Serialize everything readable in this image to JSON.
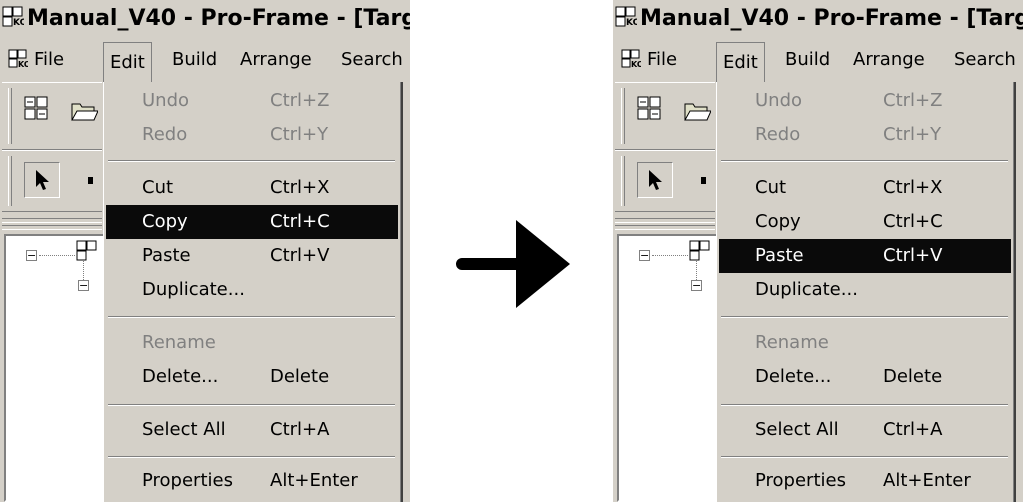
{
  "window": {
    "title": "Manual_V40 - Pro-Frame - [Targ",
    "menubar": [
      "File",
      "Edit",
      "Build",
      "Arrange",
      "Search"
    ]
  },
  "menu": {
    "items": [
      {
        "label": "Undo",
        "shortcut": "Ctrl+Z",
        "disabled": true
      },
      {
        "label": "Redo",
        "shortcut": "Ctrl+Y",
        "disabled": true
      },
      {
        "label": "Cut",
        "shortcut": "Ctrl+X",
        "disabled": false
      },
      {
        "label": "Copy",
        "shortcut": "Ctrl+C",
        "disabled": false
      },
      {
        "label": "Paste",
        "shortcut": "Ctrl+V",
        "disabled": false
      },
      {
        "label": "Duplicate...",
        "shortcut": "",
        "disabled": false
      },
      {
        "label": "Rename",
        "shortcut": "",
        "disabled": true
      },
      {
        "label": "Delete...",
        "shortcut": "Delete",
        "disabled": false
      },
      {
        "label": "Select All",
        "shortcut": "Ctrl+A",
        "disabled": false
      },
      {
        "label": "Properties",
        "shortcut": "Alt+Enter",
        "disabled": false
      }
    ]
  },
  "before": {
    "highlighted_item": "Copy"
  },
  "after": {
    "highlighted_item": "Paste"
  },
  "icons": [
    "app-logo-icon",
    "select-arrow-icon",
    "project-icon",
    "open-folder-icon",
    "tree-collapse-icon",
    "right-arrow-icon"
  ],
  "colors": {
    "window_face": "#d4d0c8",
    "highlight_bg": "#0a0a0a",
    "highlight_text": "#ffffff",
    "disabled_text": "#808080"
  }
}
